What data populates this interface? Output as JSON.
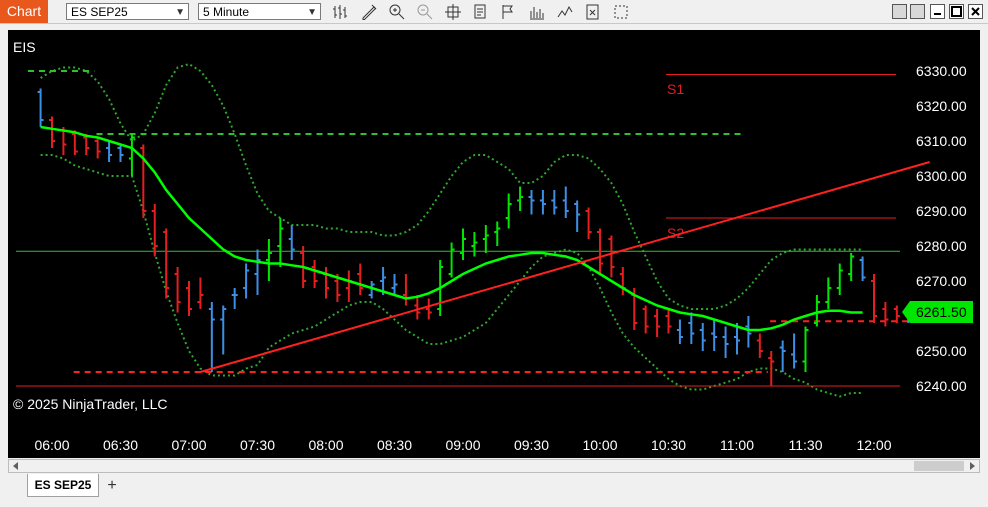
{
  "toolbar": {
    "chart_tab_label": "Chart",
    "instrument_value": "ES SEP25",
    "interval_value": "5 Minute",
    "icons": [
      "bar-type-icon",
      "drawing-tool-icon",
      "zoom-in-icon",
      "zoom-out-icon",
      "crosshair-icon",
      "data-box-icon",
      "strategies-icon",
      "indicators-icon",
      "chart-trader-icon",
      "properties-icon",
      "templates-icon"
    ]
  },
  "chart": {
    "instrument_label": "EIS",
    "copyright": "© 2025 NinjaTrader, LLC",
    "price_marker": "6261.50",
    "price_marker_color": "#00e600",
    "level_labels": [
      "S1",
      "S2"
    ],
    "colors": {
      "up": "#00e600",
      "down": "#e61e1e",
      "neutral": "#3d8fe6",
      "ma": "#00ff00",
      "band": "#2fa82f",
      "trend": "#ff2020"
    }
  },
  "chart_data": {
    "type": "candlestick",
    "ylim": [
      6233,
      6337
    ],
    "y_ticks": [
      "6330.00",
      "6320.00",
      "6310.00",
      "6300.00",
      "6290.00",
      "6280.00",
      "6270.00",
      "6260.00",
      "6250.00",
      "6240.00"
    ],
    "x_ticks": [
      "06:00",
      "06:30",
      "07:00",
      "07:30",
      "08:00",
      "08:30",
      "09:00",
      "09:30",
      "10:00",
      "10:30",
      "11:00",
      "11:30",
      "12:00"
    ],
    "bars": [
      {
        "t": "05:55",
        "o": 6324,
        "h": 6325,
        "l": 6314,
        "c": 6316,
        "dir": "n"
      },
      {
        "t": "06:00",
        "o": 6316,
        "h": 6317,
        "l": 6308,
        "c": 6310,
        "dir": "d"
      },
      {
        "t": "06:05",
        "o": 6313,
        "h": 6314,
        "l": 6306,
        "c": 6309,
        "dir": "d"
      },
      {
        "t": "06:10",
        "o": 6312,
        "h": 6313,
        "l": 6306,
        "c": 6307,
        "dir": "d"
      },
      {
        "t": "06:15",
        "o": 6311,
        "h": 6312,
        "l": 6306,
        "c": 6308,
        "dir": "d"
      },
      {
        "t": "06:20",
        "o": 6310,
        "h": 6311,
        "l": 6305,
        "c": 6307,
        "dir": "d"
      },
      {
        "t": "06:25",
        "o": 6308,
        "h": 6310,
        "l": 6304,
        "c": 6306,
        "dir": "n"
      },
      {
        "t": "06:30",
        "o": 6308,
        "h": 6309,
        "l": 6304,
        "c": 6306,
        "dir": "n"
      },
      {
        "t": "06:35",
        "o": 6305,
        "h": 6312,
        "l": 6300,
        "c": 6311,
        "dir": "u"
      },
      {
        "t": "06:40",
        "o": 6308,
        "h": 6309,
        "l": 6288,
        "c": 6290,
        "dir": "d"
      },
      {
        "t": "06:45",
        "o": 6290,
        "h": 6292,
        "l": 6277,
        "c": 6280,
        "dir": "d"
      },
      {
        "t": "06:50",
        "o": 6284,
        "h": 6285,
        "l": 6265,
        "c": 6268,
        "dir": "d"
      },
      {
        "t": "06:55",
        "o": 6272,
        "h": 6274,
        "l": 6261,
        "c": 6264,
        "dir": "d"
      },
      {
        "t": "07:00",
        "o": 6268,
        "h": 6270,
        "l": 6260,
        "c": 6262,
        "dir": "d"
      },
      {
        "t": "07:05",
        "o": 6264,
        "h": 6271,
        "l": 6262,
        "c": 6266,
        "dir": "d"
      },
      {
        "t": "07:10",
        "o": 6262,
        "h": 6264,
        "l": 6244,
        "c": 6259,
        "dir": "n"
      },
      {
        "t": "07:15",
        "o": 6259,
        "h": 6263,
        "l": 6249,
        "c": 6262,
        "dir": "n"
      },
      {
        "t": "07:20",
        "o": 6266,
        "h": 6268,
        "l": 6262,
        "c": 6266,
        "dir": "n"
      },
      {
        "t": "07:25",
        "o": 6268,
        "h": 6275,
        "l": 6265,
        "c": 6273,
        "dir": "n"
      },
      {
        "t": "07:30",
        "o": 6272,
        "h": 6279,
        "l": 6266,
        "c": 6276,
        "dir": "n"
      },
      {
        "t": "07:35",
        "o": 6276,
        "h": 6282,
        "l": 6270,
        "c": 6278,
        "dir": "u"
      },
      {
        "t": "07:40",
        "o": 6280,
        "h": 6288,
        "l": 6274,
        "c": 6285,
        "dir": "u"
      },
      {
        "t": "07:45",
        "o": 6282,
        "h": 6286,
        "l": 6276,
        "c": 6279,
        "dir": "n"
      },
      {
        "t": "07:50",
        "o": 6278,
        "h": 6280,
        "l": 6268,
        "c": 6270,
        "dir": "d"
      },
      {
        "t": "07:55",
        "o": 6274,
        "h": 6276,
        "l": 6268,
        "c": 6270,
        "dir": "d"
      },
      {
        "t": "08:00",
        "o": 6272,
        "h": 6274,
        "l": 6265,
        "c": 6268,
        "dir": "d"
      },
      {
        "t": "08:05",
        "o": 6270,
        "h": 6272,
        "l": 6264,
        "c": 6266,
        "dir": "d"
      },
      {
        "t": "08:10",
        "o": 6268,
        "h": 6273,
        "l": 6264,
        "c": 6270,
        "dir": "d"
      },
      {
        "t": "08:15",
        "o": 6272,
        "h": 6275,
        "l": 6266,
        "c": 6268,
        "dir": "d"
      },
      {
        "t": "08:20",
        "o": 6266,
        "h": 6270,
        "l": 6265,
        "c": 6269,
        "dir": "n"
      },
      {
        "t": "08:25",
        "o": 6270,
        "h": 6274,
        "l": 6266,
        "c": 6271,
        "dir": "n"
      },
      {
        "t": "08:30",
        "o": 6268,
        "h": 6272,
        "l": 6266,
        "c": 6269,
        "dir": "n"
      },
      {
        "t": "08:35",
        "o": 6266,
        "h": 6272,
        "l": 6263,
        "c": 6265,
        "dir": "d"
      },
      {
        "t": "08:40",
        "o": 6263,
        "h": 6266,
        "l": 6259,
        "c": 6261,
        "dir": "d"
      },
      {
        "t": "08:45",
        "o": 6262,
        "h": 6265,
        "l": 6259,
        "c": 6261,
        "dir": "d"
      },
      {
        "t": "08:50",
        "o": 6262,
        "h": 6276,
        "l": 6260,
        "c": 6274,
        "dir": "u"
      },
      {
        "t": "08:55",
        "o": 6272,
        "h": 6281,
        "l": 6271,
        "c": 6279,
        "dir": "u"
      },
      {
        "t": "09:00",
        "o": 6278,
        "h": 6285,
        "l": 6276,
        "c": 6282,
        "dir": "u"
      },
      {
        "t": "09:05",
        "o": 6280,
        "h": 6284,
        "l": 6277,
        "c": 6281,
        "dir": "u"
      },
      {
        "t": "09:10",
        "o": 6282,
        "h": 6286,
        "l": 6278,
        "c": 6283,
        "dir": "u"
      },
      {
        "t": "09:15",
        "o": 6284,
        "h": 6287,
        "l": 6280,
        "c": 6285,
        "dir": "u"
      },
      {
        "t": "09:20",
        "o": 6288,
        "h": 6295,
        "l": 6285,
        "c": 6292,
        "dir": "u"
      },
      {
        "t": "09:25",
        "o": 6293,
        "h": 6297,
        "l": 6290,
        "c": 6294,
        "dir": "u"
      },
      {
        "t": "09:30",
        "o": 6294,
        "h": 6296,
        "l": 6289,
        "c": 6293,
        "dir": "n"
      },
      {
        "t": "09:35",
        "o": 6293,
        "h": 6296,
        "l": 6289,
        "c": 6292,
        "dir": "n"
      },
      {
        "t": "09:40",
        "o": 6293,
        "h": 6296,
        "l": 6289,
        "c": 6291,
        "dir": "n"
      },
      {
        "t": "09:45",
        "o": 6293,
        "h": 6297,
        "l": 6288,
        "c": 6290,
        "dir": "n"
      },
      {
        "t": "09:50",
        "o": 6292,
        "h": 6293,
        "l": 6284,
        "c": 6289,
        "dir": "n"
      },
      {
        "t": "09:55",
        "o": 6290,
        "h": 6291,
        "l": 6282,
        "c": 6284,
        "dir": "d"
      },
      {
        "t": "10:00",
        "o": 6284,
        "h": 6285,
        "l": 6272,
        "c": 6275,
        "dir": "d"
      },
      {
        "t": "10:05",
        "o": 6282,
        "h": 6283,
        "l": 6271,
        "c": 6274,
        "dir": "d"
      },
      {
        "t": "10:10",
        "o": 6272,
        "h": 6274,
        "l": 6266,
        "c": 6268,
        "dir": "d"
      },
      {
        "t": "10:15",
        "o": 6266,
        "h": 6268,
        "l": 6256,
        "c": 6258,
        "dir": "d"
      },
      {
        "t": "10:20",
        "o": 6262,
        "h": 6263,
        "l": 6255,
        "c": 6257,
        "dir": "d"
      },
      {
        "t": "10:25",
        "o": 6260,
        "h": 6262,
        "l": 6254,
        "c": 6257,
        "dir": "d"
      },
      {
        "t": "10:30",
        "o": 6260,
        "h": 6262,
        "l": 6255,
        "c": 6257,
        "dir": "d"
      },
      {
        "t": "10:35",
        "o": 6256,
        "h": 6259,
        "l": 6252,
        "c": 6254,
        "dir": "n"
      },
      {
        "t": "10:40",
        "o": 6258,
        "h": 6261,
        "l": 6252,
        "c": 6255,
        "dir": "n"
      },
      {
        "t": "10:45",
        "o": 6256,
        "h": 6258,
        "l": 6250,
        "c": 6253,
        "dir": "n"
      },
      {
        "t": "10:50",
        "o": 6255,
        "h": 6259,
        "l": 6250,
        "c": 6254,
        "dir": "n"
      },
      {
        "t": "10:55",
        "o": 6254,
        "h": 6257,
        "l": 6248,
        "c": 6252,
        "dir": "n"
      },
      {
        "t": "11:00",
        "o": 6254,
        "h": 6258,
        "l": 6249,
        "c": 6253,
        "dir": "n"
      },
      {
        "t": "11:05",
        "o": 6257,
        "h": 6260,
        "l": 6251,
        "c": 6255,
        "dir": "n"
      },
      {
        "t": "11:10",
        "o": 6253,
        "h": 6255,
        "l": 6248,
        "c": 6250,
        "dir": "d"
      },
      {
        "t": "11:15",
        "o": 6248,
        "h": 6250,
        "l": 6240,
        "c": 6247,
        "dir": "d"
      },
      {
        "t": "11:20",
        "o": 6251,
        "h": 6253,
        "l": 6244,
        "c": 6250,
        "dir": "n"
      },
      {
        "t": "11:25",
        "o": 6249,
        "h": 6255,
        "l": 6245,
        "c": 6247,
        "dir": "n"
      },
      {
        "t": "11:30",
        "o": 6247,
        "h": 6257,
        "l": 6244,
        "c": 6256,
        "dir": "u"
      },
      {
        "t": "11:35",
        "o": 6258,
        "h": 6266,
        "l": 6257,
        "c": 6264,
        "dir": "u"
      },
      {
        "t": "11:40",
        "o": 6264,
        "h": 6271,
        "l": 6262,
        "c": 6268,
        "dir": "u"
      },
      {
        "t": "11:45",
        "o": 6268,
        "h": 6275,
        "l": 6266,
        "c": 6273,
        "dir": "u"
      },
      {
        "t": "11:50",
        "o": 6272,
        "h": 6278,
        "l": 6270,
        "c": 6277,
        "dir": "u"
      },
      {
        "t": "11:55",
        "o": 6276,
        "h": 6277,
        "l": 6270,
        "c": 6271,
        "dir": "n"
      },
      {
        "t": "12:00",
        "o": 6270,
        "h": 6272,
        "l": 6258,
        "c": 6260,
        "dir": "d"
      },
      {
        "t": "12:05",
        "o": 6262,
        "h": 6264,
        "l": 6257,
        "c": 6259,
        "dir": "d"
      },
      {
        "t": "12:10",
        "o": 6262,
        "h": 6263,
        "l": 6258,
        "c": 6260,
        "dir": "d"
      },
      {
        "t": "12:15",
        "o": 6260,
        "h": 6263,
        "l": 6258,
        "c": 6261.5,
        "dir": "n"
      }
    ],
    "moving_average": [
      6314,
      6313.5,
      6313,
      6312.5,
      6311.5,
      6311,
      6310,
      6309,
      6308,
      6305,
      6301,
      6296,
      6292,
      6288,
      6285,
      6282,
      6279,
      6277,
      6276,
      6275.5,
      6275,
      6275,
      6274.5,
      6274,
      6273,
      6272,
      6271,
      6270,
      6269,
      6268,
      6267,
      6266,
      6265,
      6265.5,
      6266.5,
      6268,
      6270,
      6272,
      6273.5,
      6275,
      6276,
      6277,
      6277.5,
      6278,
      6278,
      6277.5,
      6277,
      6276,
      6274,
      6272,
      6270,
      6268,
      6266,
      6264.5,
      6263,
      6262,
      6261,
      6260.5,
      6260,
      6259,
      6258,
      6257,
      6256,
      6256,
      6256.5,
      6257.5,
      6259,
      6260,
      6261,
      6261.5,
      6261.5,
      6261,
      6261
    ],
    "upper_band": [
      6328,
      6330,
      6331,
      6331,
      6330,
      6327,
      6322,
      6315,
      6310,
      6312,
      6318,
      6326,
      6331,
      6332,
      6330,
      6326,
      6320,
      6312,
      6303,
      6295,
      6290,
      6288,
      6286,
      6286,
      6286,
      6285,
      6285,
      6284,
      6284,
      6284,
      6283,
      6283,
      6284,
      6286,
      6290,
      6295,
      6300,
      6304,
      6306,
      6306,
      6304,
      6302,
      6298,
      6298,
      6300,
      6304,
      6306,
      6306,
      6305,
      6302,
      6298,
      6292,
      6284,
      6277,
      6270,
      6265,
      6263,
      6262,
      6262,
      6262,
      6263,
      6265,
      6268,
      6272,
      6276,
      6278,
      6279,
      6279,
      6279,
      6279,
      6279,
      6279,
      6279
    ],
    "lower_band": [
      6306,
      6306,
      6305,
      6303,
      6302,
      6301,
      6300,
      6300,
      6300,
      6290,
      6278,
      6267,
      6258,
      6250,
      6245,
      6243,
      6243,
      6243,
      6245,
      6246,
      6251,
      6253,
      6255,
      6256,
      6257,
      6259,
      6261,
      6263,
      6264,
      6264,
      6262,
      6259,
      6256,
      6254,
      6252,
      6252,
      6253,
      6254,
      6256,
      6258,
      6262,
      6266,
      6270,
      6274,
      6277,
      6278,
      6279,
      6278,
      6274,
      6268,
      6261,
      6255,
      6251,
      6248,
      6245,
      6242,
      6240,
      6239,
      6239,
      6240,
      6241,
      6242,
      6244,
      6245,
      6245,
      6244,
      6242,
      6241,
      6239,
      6238,
      6237,
      6238,
      6238
    ],
    "levels": [
      {
        "name": "S1",
        "price": 6329
      },
      {
        "name": "S2",
        "price": 6288
      }
    ],
    "horizontal_lines": [
      {
        "price": 6278.5,
        "style": "solid",
        "color": "green"
      },
      {
        "price": 6240,
        "style": "solid",
        "color": "red"
      }
    ],
    "dashed_levels": [
      {
        "price": 6330,
        "color": "green",
        "from": "06:00",
        "to": "06:15"
      },
      {
        "price": 6312,
        "color": "green",
        "from": "06:30",
        "to": "11:00"
      },
      {
        "price": 6244,
        "color": "red",
        "from": "06:20",
        "to": "11:10"
      },
      {
        "price": 6258.5,
        "color": "red",
        "from": "11:25",
        "to": "12:15"
      }
    ],
    "trend_line": {
      "from": {
        "t": "07:05",
        "price": 6244
      },
      "to": {
        "t": "12:20",
        "price": 6304
      }
    }
  }
}
